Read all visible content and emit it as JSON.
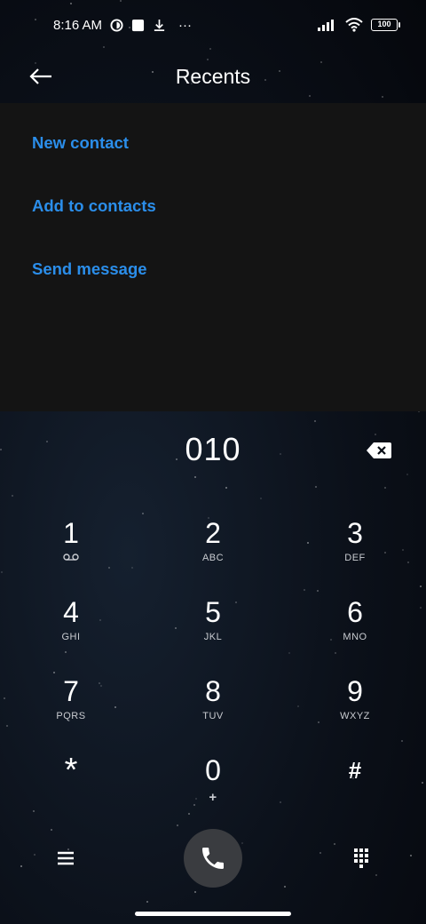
{
  "status_bar": {
    "time": "8:16 AM",
    "more": "···",
    "battery": "100"
  },
  "header": {
    "title": "Recents"
  },
  "actions": [
    {
      "label": "New contact"
    },
    {
      "label": "Add to contacts"
    },
    {
      "label": "Send message"
    }
  ],
  "dialer": {
    "number": "010"
  },
  "keypad": [
    {
      "digit": "1",
      "letters": ""
    },
    {
      "digit": "2",
      "letters": "ABC"
    },
    {
      "digit": "3",
      "letters": "DEF"
    },
    {
      "digit": "4",
      "letters": "GHI"
    },
    {
      "digit": "5",
      "letters": "JKL"
    },
    {
      "digit": "6",
      "letters": "MNO"
    },
    {
      "digit": "7",
      "letters": "PQRS"
    },
    {
      "digit": "8",
      "letters": "TUV"
    },
    {
      "digit": "9",
      "letters": "WXYZ"
    },
    {
      "digit": "*",
      "letters": ""
    },
    {
      "digit": "0",
      "letters": "+"
    },
    {
      "digit": "#",
      "letters": ""
    }
  ],
  "icons": {
    "back": "arrow-left-icon",
    "backspace": "backspace-icon",
    "voicemail": "voicemail-icon",
    "menu": "menu-icon",
    "call": "phone-icon",
    "dialpad": "dialpad-icon"
  },
  "colors": {
    "accent": "#2b8eea",
    "panel": "#141414",
    "call_button": "#3a3c40"
  }
}
